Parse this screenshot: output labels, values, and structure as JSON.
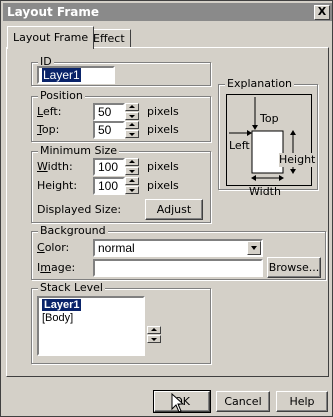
{
  "window": {
    "title": "Layout Frame",
    "close_label": "X"
  },
  "tabs": [
    {
      "label": "Layout Frame",
      "active": true
    },
    {
      "label": "Effect",
      "active": false
    }
  ],
  "id_group": {
    "label": "ID",
    "value": "Layer1"
  },
  "position": {
    "label": "Position",
    "left_label": "Left:",
    "left_value": "50",
    "top_label": "Top:",
    "top_value": "50",
    "unit": "pixels"
  },
  "minimum_size": {
    "label": "Minimum Size",
    "width_label": "Width:",
    "width_value": "100",
    "height_label": "Height:",
    "height_value": "100",
    "unit": "pixels",
    "displayed_label": "Displayed Size:",
    "adjust_label": "Adjust"
  },
  "explanation": {
    "label": "Explanation",
    "top": "Top",
    "left": "Left",
    "height": "Height",
    "width": "Width"
  },
  "background": {
    "label": "Background",
    "color_label": "Color:",
    "color_value": "normal",
    "image_label": "Image:",
    "image_value": "",
    "browse_label": "Browse..."
  },
  "stack": {
    "label": "Stack Level",
    "items": [
      "Layer1",
      "[Body]"
    ]
  },
  "footer": {
    "ok": "OK",
    "cancel": "Cancel",
    "help": "Help"
  }
}
